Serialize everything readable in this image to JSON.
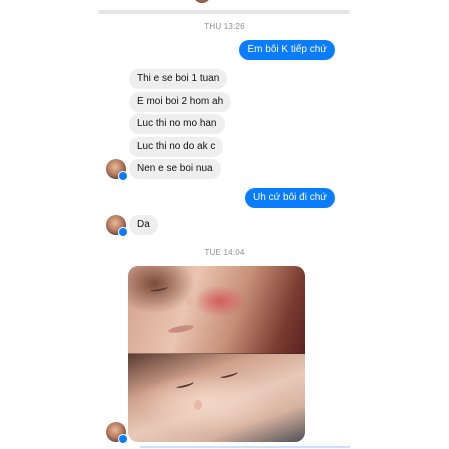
{
  "conversation": {
    "timestamp_1": "THU 13:26",
    "timestamp_2": "TUE 14:04",
    "messages": [
      {
        "sender": "me",
        "text": "Em bôi K tiếp chứ"
      },
      {
        "sender": "them",
        "text": "Thi e se boi 1 tuan"
      },
      {
        "sender": "them",
        "text": "E moi boi 2 hom ah"
      },
      {
        "sender": "them",
        "text": "Luc thi no mo han"
      },
      {
        "sender": "them",
        "text": "Luc thi no do ak c"
      },
      {
        "sender": "them",
        "text": "Nen e se boi nua"
      },
      {
        "sender": "me",
        "text": "Uh cứ bôi đi chứ"
      },
      {
        "sender": "them",
        "text": "Da"
      }
    ],
    "attachment": {
      "type": "photo",
      "description_icon": "photo-attachment"
    }
  },
  "colors": {
    "outgoing_bubble": "#0a7cff",
    "incoming_bubble": "#eeeeee",
    "timestamp_text": "#8e8e93"
  }
}
